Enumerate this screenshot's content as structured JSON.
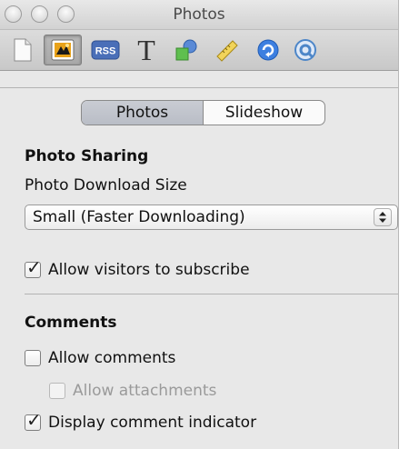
{
  "window": {
    "title": "Photos"
  },
  "toolbar": {
    "items": [
      {
        "icon": "document-icon"
      },
      {
        "icon": "photos-icon",
        "selected": true
      },
      {
        "icon": "rss-icon",
        "label": "RSS"
      },
      {
        "icon": "text-icon",
        "label": "T"
      },
      {
        "icon": "shapes-icon"
      },
      {
        "icon": "ruler-icon"
      },
      {
        "icon": "hyperlink-icon"
      },
      {
        "icon": "quicktime-icon"
      }
    ]
  },
  "tabs": [
    {
      "label": "Photos",
      "active": true
    },
    {
      "label": "Slideshow",
      "active": false
    }
  ],
  "photo_sharing": {
    "heading": "Photo Sharing",
    "download_size_label": "Photo Download Size",
    "download_size_value": "Small (Faster Downloading)",
    "subscribe_label": "Allow visitors to subscribe",
    "subscribe_checked": true
  },
  "comments": {
    "heading": "Comments",
    "allow_comments_label": "Allow comments",
    "allow_comments_checked": false,
    "allow_attachments_label": "Allow attachments",
    "allow_attachments_checked": false,
    "allow_attachments_enabled": false,
    "display_indicator_label": "Display comment indicator",
    "display_indicator_checked": true
  },
  "colors": {
    "tab_active": "#c4c8cf",
    "window_bg": "#e8e8e8"
  }
}
